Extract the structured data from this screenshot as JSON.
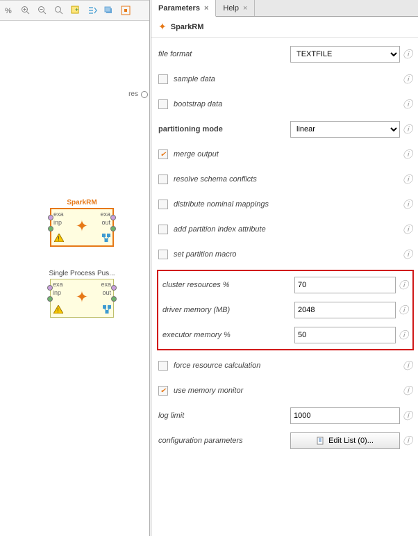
{
  "tabs": {
    "parameters": "Parameters",
    "help": "Help"
  },
  "header": {
    "operator_name": "SparkRM"
  },
  "canvas": {
    "res_label": "res",
    "op1": {
      "name": "SparkRM",
      "port_exa": "exa",
      "port_inp": "inp",
      "port_out": "out"
    },
    "op2": {
      "name": "Single Process Pus...",
      "port_exa": "exa",
      "port_inp": "inp",
      "port_out": "out"
    }
  },
  "params": {
    "file_format": {
      "label": "file format",
      "value": "TEXTFILE"
    },
    "sample_data": {
      "label": "sample data",
      "checked": false
    },
    "bootstrap_data": {
      "label": "bootstrap data",
      "checked": false
    },
    "partitioning_mode": {
      "label": "partitioning mode",
      "value": "linear"
    },
    "merge_output": {
      "label": "merge output",
      "checked": true
    },
    "resolve_schema": {
      "label": "resolve schema conflicts",
      "checked": false
    },
    "distribute_nominal": {
      "label": "distribute nominal mappings",
      "checked": false
    },
    "add_partition_index": {
      "label": "add partition index attribute",
      "checked": false
    },
    "set_partition_macro": {
      "label": "set partition macro",
      "checked": false
    },
    "cluster_resources": {
      "label": "cluster resources %",
      "value": "70"
    },
    "driver_memory": {
      "label": "driver memory (MB)",
      "value": "2048"
    },
    "executor_memory": {
      "label": "executor memory %",
      "value": "50"
    },
    "force_resource": {
      "label": "force resource calculation",
      "checked": false
    },
    "use_memory_monitor": {
      "label": "use memory monitor",
      "checked": true
    },
    "log_limit": {
      "label": "log limit",
      "value": "1000"
    },
    "config_params": {
      "label": "configuration parameters",
      "button": "Edit List (0)..."
    }
  }
}
